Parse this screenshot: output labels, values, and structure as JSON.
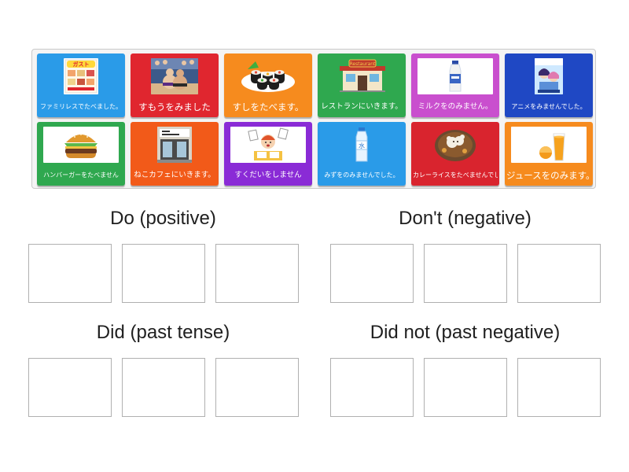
{
  "cards": [
    {
      "text": "ファミリレスでたべました。",
      "color": "#2a9be8",
      "icon": "family-restaurant-menu-icon",
      "size": "s"
    },
    {
      "text": "すもうをみました",
      "color": "#e0262f",
      "icon": "sumo-wrestlers-icon",
      "size": "l"
    },
    {
      "text": "すしをたべます。",
      "color": "#f68b1e",
      "icon": "sushi-rolls-icon",
      "size": "l"
    },
    {
      "text": "レストランにいきます。",
      "color": "#2fa84f",
      "icon": "restaurant-building-icon",
      "size": "m",
      "sign": "Restaurant"
    },
    {
      "text": "ミルクをのみません。",
      "color": "#c94fce",
      "icon": "milk-bottle-icon",
      "size": "m"
    },
    {
      "text": "アニメをみませんでした。",
      "color": "#1f48c4",
      "icon": "anime-poster-icon",
      "size": "s"
    },
    {
      "text": "ハンバーガーをたべません",
      "color": "#2fa84f",
      "icon": "hamburger-icon",
      "size": "s"
    },
    {
      "text": "ねこカフェにいきます。",
      "color": "#f25a19",
      "icon": "cat-cafe-icon",
      "size": "m"
    },
    {
      "text": "すくだいをしません",
      "color": "#8a2bd6",
      "icon": "homework-child-icon",
      "size": "m"
    },
    {
      "text": "みずをのみませんでした。",
      "color": "#2a9be8",
      "icon": "water-bottle-icon",
      "size": "s"
    },
    {
      "text": "カレーライスをたべませんでした。",
      "color": "#d9242e",
      "icon": "curry-rice-icon",
      "size": "s"
    },
    {
      "text": "ジュースをのみます。",
      "color": "#f68b1e",
      "icon": "orange-juice-icon",
      "size": "l"
    }
  ],
  "groups": [
    {
      "title": "Do (positive)"
    },
    {
      "title": "Don't (negative)"
    },
    {
      "title": "Did (past tense)"
    },
    {
      "title": "Did not (past negative)"
    }
  ]
}
